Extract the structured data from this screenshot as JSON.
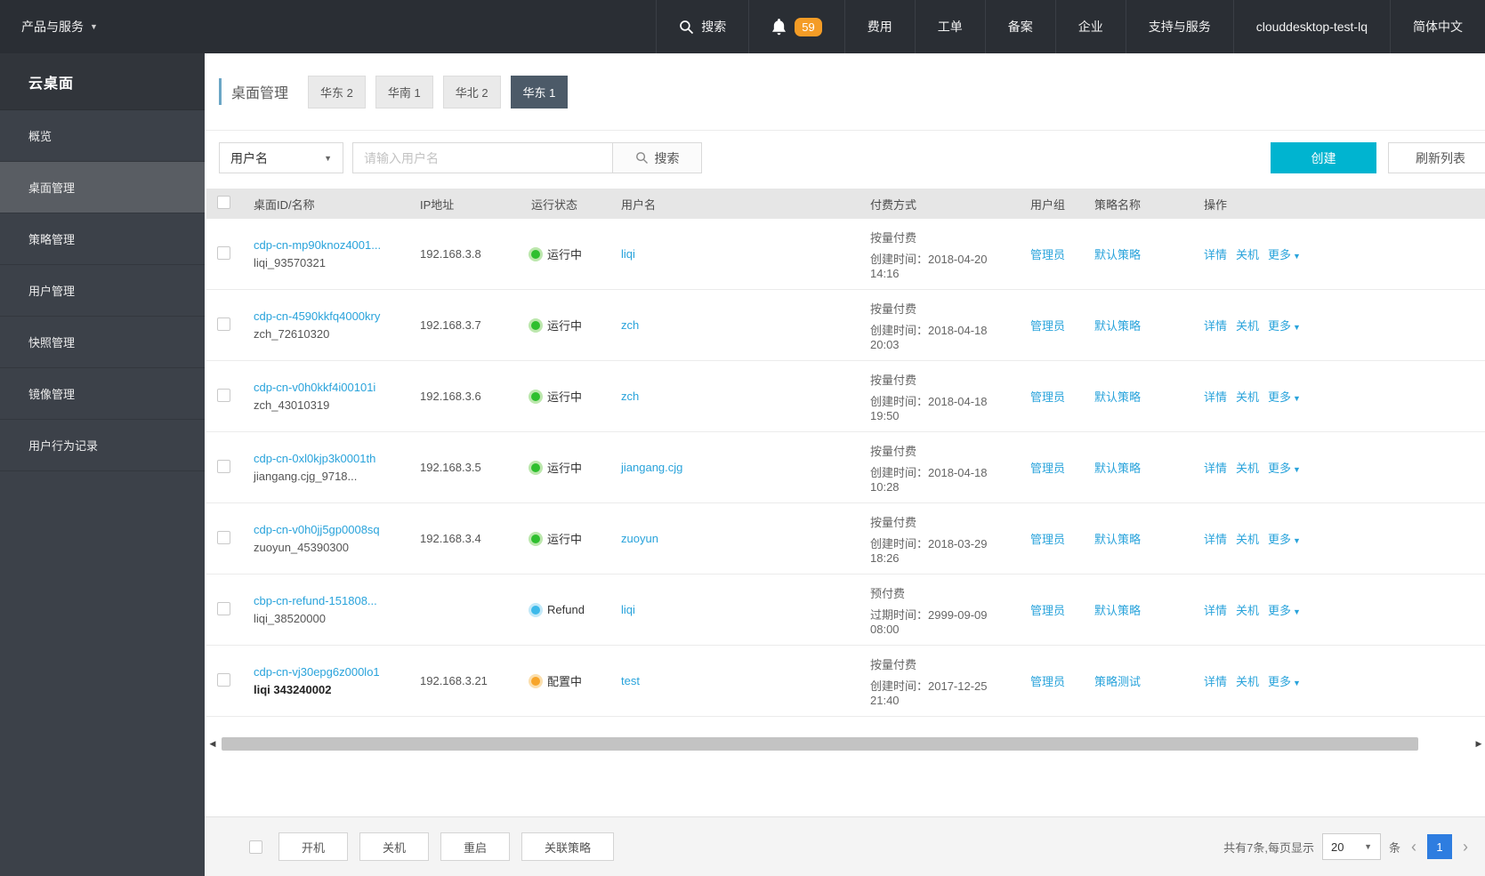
{
  "topbar": {
    "product_menu": "产品与服务",
    "search_label": "搜索",
    "notification_count": "59",
    "nav_items": [
      "费用",
      "工单",
      "备案",
      "企业",
      "支持与服务"
    ],
    "account": "clouddesktop-test-lq",
    "language": "简体中文"
  },
  "sidebar": {
    "title": "云桌面",
    "items": [
      {
        "label": "概览",
        "active": false
      },
      {
        "label": "桌面管理",
        "active": true
      },
      {
        "label": "策略管理",
        "active": false
      },
      {
        "label": "用户管理",
        "active": false
      },
      {
        "label": "快照管理",
        "active": false
      },
      {
        "label": "镜像管理",
        "active": false
      },
      {
        "label": "用户行为记录",
        "active": false
      }
    ]
  },
  "page": {
    "title": "桌面管理",
    "region_tabs": [
      {
        "label": "华东 2",
        "active": false
      },
      {
        "label": "华南 1",
        "active": false
      },
      {
        "label": "华北 2",
        "active": false
      },
      {
        "label": "华东 1",
        "active": true
      }
    ]
  },
  "toolbar": {
    "filter_field": "用户名",
    "search_placeholder": "请输入用户名",
    "search_button": "搜索",
    "create_button": "创建",
    "refresh_button": "刷新列表"
  },
  "table": {
    "columns": [
      "桌面ID/名称",
      "IP地址",
      "运行状态",
      "用户名",
      "付费方式",
      "用户组",
      "策略名称",
      "操作"
    ],
    "actions": [
      "详情",
      "关机",
      "更多"
    ],
    "rows": [
      {
        "id": "cdp-cn-mp90knoz4001...",
        "name": "liqi_93570321",
        "bold": false,
        "ip": "192.168.3.8",
        "status": "运行中",
        "dot": "#2fbf2f",
        "halo": "#bce7ad",
        "user": "liqi",
        "pay_type": "按量付费",
        "pay_detail": "创建时间：2018-04-20 14:16",
        "group": "管理员",
        "policy": "默认策略"
      },
      {
        "id": "cdp-cn-4590kkfq4000kry",
        "name": "zch_72610320",
        "bold": false,
        "ip": "192.168.3.7",
        "status": "运行中",
        "dot": "#2fbf2f",
        "halo": "#bce7ad",
        "user": "zch",
        "pay_type": "按量付费",
        "pay_detail": "创建时间：2018-04-18 20:03",
        "group": "管理员",
        "policy": "默认策略"
      },
      {
        "id": "cdp-cn-v0h0kkf4i00101i",
        "name": "zch_43010319",
        "bold": false,
        "ip": "192.168.3.6",
        "status": "运行中",
        "dot": "#2fbf2f",
        "halo": "#bce7ad",
        "user": "zch",
        "pay_type": "按量付费",
        "pay_detail": "创建时间：2018-04-18 19:50",
        "group": "管理员",
        "policy": "默认策略"
      },
      {
        "id": "cdp-cn-0xl0kjp3k0001th",
        "name": "jiangang.cjg_9718...",
        "bold": false,
        "ip": "192.168.3.5",
        "status": "运行中",
        "dot": "#2fbf2f",
        "halo": "#bce7ad",
        "user": "jiangang.cjg",
        "pay_type": "按量付费",
        "pay_detail": "创建时间：2018-04-18 10:28",
        "group": "管理员",
        "policy": "默认策略"
      },
      {
        "id": "cdp-cn-v0h0jj5gp0008sq",
        "name": "zuoyun_45390300",
        "bold": false,
        "ip": "192.168.3.4",
        "status": "运行中",
        "dot": "#2fbf2f",
        "halo": "#bce7ad",
        "user": "zuoyun",
        "pay_type": "按量付费",
        "pay_detail": "创建时间：2018-03-29 18:26",
        "group": "管理员",
        "policy": "默认策略"
      },
      {
        "id": "cbp-cn-refund-151808...",
        "name": "liqi_38520000",
        "bold": false,
        "ip": "",
        "status": "Refund",
        "dot": "#3db9ea",
        "halo": "#c3e9f8",
        "user": "liqi",
        "pay_type": "预付费",
        "pay_detail": "过期时间：2999-09-09 08:00",
        "group": "管理员",
        "policy": "默认策略"
      },
      {
        "id": "cdp-cn-vj30epg6z000lo1",
        "name": "liqi 343240002",
        "bold": true,
        "ip": "192.168.3.21",
        "status": "配置中",
        "dot": "#f7a52b",
        "halo": "#fbdfae",
        "user": "test",
        "pay_type": "按量付费",
        "pay_detail": "创建时间：2017-12-25 21:40",
        "group": "管理员",
        "policy": "策略测试"
      }
    ]
  },
  "footer": {
    "buttons": [
      "开机",
      "关机",
      "重启",
      "关联策略"
    ],
    "total_text": "共有7条,每页显示",
    "page_size": "20",
    "unit": "条",
    "page": "1"
  },
  "icons": {
    "caret_down": "▼",
    "chevron_left": "‹",
    "chevron_right": "›",
    "scroll_left": "◀",
    "scroll_right": "▶"
  },
  "colors": {
    "topbar_bg": "#2a2e34",
    "sidebar_bg": "#3c4149",
    "accent_cyan": "#00b4d0",
    "link_blue": "#29a3db",
    "badge_orange": "#f49c26",
    "tab_active_bg": "#4c5a68",
    "pagination_active": "#2e7de0",
    "status_running": "#2fbf2f",
    "status_refund": "#3db9ea",
    "status_configuring": "#f7a52b"
  }
}
